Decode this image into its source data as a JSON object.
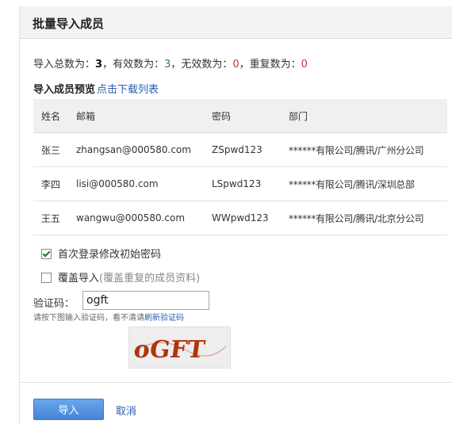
{
  "header": {
    "title": "批量导入成员"
  },
  "stats": {
    "total_label": "导入总数为：",
    "total": "3",
    "valid_label": "，有效数为：",
    "valid": "3",
    "invalid_label": "，无效数为：",
    "invalid": "0",
    "dup_label": "，重复数为：",
    "dup": "0"
  },
  "preview": {
    "label": "导入成员预览",
    "download_link": "点击下载列表"
  },
  "table": {
    "headers": [
      "姓名",
      "邮箱",
      "密码",
      "部门"
    ],
    "rows": [
      [
        "张三",
        "zhangsan@000580.com",
        "ZSpwd123",
        "******有限公司/腾讯/广州分公司"
      ],
      [
        "李四",
        "lisi@000580.com",
        "LSpwd123",
        "******有限公司/腾讯/深圳总部"
      ],
      [
        "王五",
        "wangwu@000580.com",
        "WWpwd123",
        "******有限公司/腾讯/北京分公司"
      ]
    ]
  },
  "options": {
    "first_login": {
      "label": "首次登录修改初始密码",
      "checked": true
    },
    "overwrite": {
      "label": "覆盖导入",
      "hint": "(覆盖重复的成员资料)",
      "checked": false
    }
  },
  "captcha": {
    "label": "验证码：",
    "value": "ogft",
    "hint": "请按下图输入验证码，看不清请",
    "refresh": "刷新验证码",
    "image_text": "oGFT"
  },
  "actions": {
    "import": "导入",
    "cancel": "取消"
  },
  "colors": {
    "link": "#2a5db0",
    "primary_button": "#4f8fdf",
    "captcha_text": "#b0340c"
  }
}
